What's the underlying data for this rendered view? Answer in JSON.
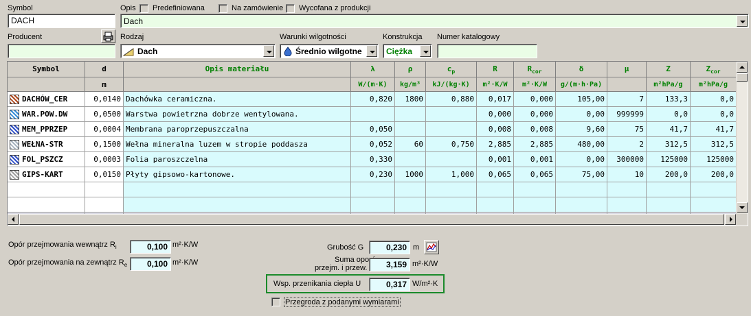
{
  "header": {
    "symbol_label": "Symbol",
    "symbol_value": "DACH",
    "opis_label": "Opis",
    "predef_label": "Predefiniowana",
    "zamowienie_label": "Na zamówienie",
    "wycofana_label": "Wycofana z produkcji",
    "opis_value": "Dach",
    "producent_label": "Producent",
    "producent_value": "",
    "rodzaj_label": "Rodzaj",
    "rodzaj_value": "Dach",
    "warunki_label": "Warunki wilgotności",
    "warunki_value": "Średnio wilgotne",
    "konstrukcja_label": "Konstrukcja",
    "konstrukcja_value": "Ciężka",
    "katalog_label": "Numer katalogowy",
    "katalog_value": ""
  },
  "grid": {
    "columns": [
      {
        "head": "Symbol",
        "unit": ""
      },
      {
        "head": "d",
        "unit": "m"
      },
      {
        "head": "Opis materiału",
        "unit": ""
      },
      {
        "head": "λ",
        "unit": "W/(m·K)"
      },
      {
        "head": "ρ",
        "unit": "kg/m³"
      },
      {
        "head": "cp",
        "unit": "kJ/(kg·K)"
      },
      {
        "head": "R",
        "unit": "m²·K/W"
      },
      {
        "head": "Rcor",
        "unit": "m²·K/W"
      },
      {
        "head": "δ",
        "unit": "g/(m·h·Pa)"
      },
      {
        "head": "μ",
        "unit": ""
      },
      {
        "head": "Z",
        "unit": "m²hPa/g"
      },
      {
        "head": "Zcor",
        "unit": "m²hPa/g"
      }
    ],
    "rows": [
      {
        "icon": "roof-tile-icon",
        "color": "#b04a20",
        "cells": [
          "DACHÓW_CER",
          "0,0140",
          "Dachówka ceramiczna.",
          "0,820",
          "1800",
          "0,880",
          "0,017",
          "0,000",
          "105,00",
          "7",
          "133,3",
          "0,0"
        ]
      },
      {
        "icon": "air-layer-icon",
        "color": "#3a8fd8",
        "cells": [
          "WAR.POW.DW",
          "0,0500",
          "Warstwa powietrzna dobrze wentylowana.",
          "",
          "",
          "",
          "0,000",
          "0,000",
          "0,00",
          "999999",
          "0,0",
          "0,0"
        ]
      },
      {
        "icon": "membrane-icon",
        "color": "#3050c8",
        "cells": [
          "MEM_PPRZEP",
          "0,0004",
          "Membrana paroprzepuszczalna",
          "0,050",
          "",
          "",
          "0,008",
          "0,008",
          "9,60",
          "75",
          "41,7",
          "41,7"
        ]
      },
      {
        "icon": "wool-icon",
        "color": "#a8b4c0",
        "cells": [
          "WEŁNA-STR",
          "0,1500",
          "Wełna mineralna luzem w stropie poddasza",
          "0,052",
          "60",
          "0,750",
          "2,885",
          "2,885",
          "480,00",
          "2",
          "312,5",
          "312,5"
        ]
      },
      {
        "icon": "foil-icon",
        "color": "#3050c8",
        "cells": [
          "FOL_PSZCZ",
          "0,0003",
          "Folia paroszczelna",
          "0,330",
          "",
          "",
          "0,001",
          "0,001",
          "0,00",
          "300000",
          "125000",
          "125000"
        ]
      },
      {
        "icon": "drywall-icon",
        "color": "#a0a0a0",
        "cells": [
          "GIPS-KART",
          "0,0150",
          "Płyty gipsowo-kartonowe.",
          "0,230",
          "1000",
          "1,000",
          "0,065",
          "0,065",
          "75,00",
          "10",
          "200,0",
          "200,0"
        ]
      }
    ]
  },
  "footer": {
    "rsi_label": "Opór przejmowania wewnątrz R",
    "rsi_sub": "i",
    "rsi_value": "0,100",
    "rsi_unit": "m²·K/W",
    "rse_label": "Opór przejmowania na zewnątrz R",
    "rse_sub": "e",
    "rse_value": "0,100",
    "rse_unit": "m²·K/W",
    "grubosc_label": "Grubość G",
    "grubosc_value": "0,230",
    "grubosc_unit": "m",
    "suma_label_1": "Suma oporów",
    "suma_label_2": "przejm. i przew.",
    "suma_value": "3,159",
    "suma_unit": "m²·K/W",
    "u_label": "Wsp. przenikania ciepła U",
    "u_value": "0,317",
    "u_unit": "W/m²·K",
    "przegroda_label": "Przegroda z podanymi wymiarami"
  }
}
